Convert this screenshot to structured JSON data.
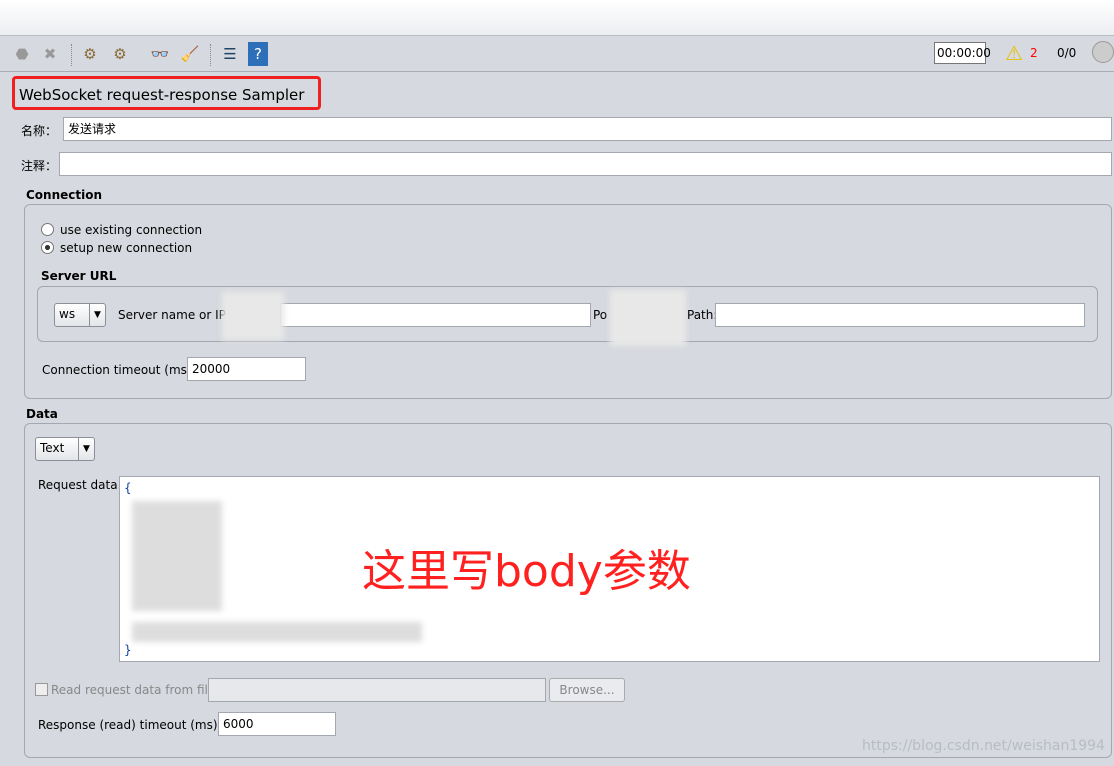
{
  "toolbar": {
    "icons": [
      "stop-icon",
      "shutdown-icon",
      "clear-icon",
      "clear-all-icon",
      "search-icon",
      "reset-search-icon",
      "function-helper-icon",
      "help-icon"
    ],
    "timer": "00:00:00",
    "warning_count": "2",
    "thread_count": "0/0"
  },
  "sampler": {
    "title": "WebSocket request-response Sampler",
    "name_label": "名称：",
    "name_value": "发送请求",
    "comment_label": "注释：",
    "comment_value": ""
  },
  "connection": {
    "title": "Connection",
    "use_existing": "use existing connection",
    "setup_new": "setup new connection",
    "selected": "setup new connection",
    "server_url_title": "Server URL",
    "protocol": "ws",
    "server_label": "Server name or IP",
    "port_label": "Po",
    "path_label": "Path:",
    "server_value": "",
    "port_value": "",
    "path_value": "",
    "timeout_label": "Connection timeout (ms):",
    "timeout_value": "20000"
  },
  "data": {
    "title": "Data",
    "type": "Text",
    "request_label": "Request data:",
    "open_brace": "{",
    "close_brace": "}",
    "file_checkbox_label": "Read request data from file:",
    "browse": "Browse...",
    "response_timeout_label": "Response (read) timeout (ms):",
    "response_timeout_value": "6000"
  },
  "annotation": {
    "text": "这里写body参数",
    "color": "#ff2020"
  },
  "watermark": "https://blog.csdn.net/weishan1994"
}
